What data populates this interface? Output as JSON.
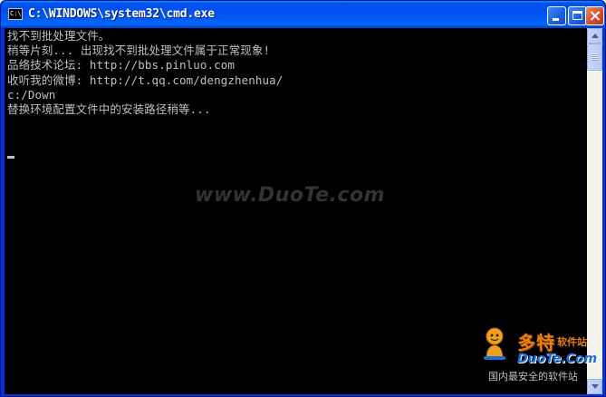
{
  "window": {
    "title": "C:\\WINDOWS\\system32\\cmd.exe",
    "icon": "C:\\"
  },
  "console": {
    "lines": [
      "找不到批处理文件。",
      "稍等片刻... 出现找不到批处理文件属于正常现象!",
      "品络技术论坛: http://bbs.pinluo.com",
      "收听我的微博: http://t.qq.com/dengzhenhua/",
      "c:/Down",
      "替换环境配置文件中的安装路径稍等..."
    ]
  },
  "watermark": "www.DuoTe.com",
  "logo": {
    "name": "多特",
    "tag": "软件站",
    "domain": "DuoTe.Com",
    "slogan": "国内最安全的软件站"
  },
  "colors": {
    "console_bg": "#000000",
    "console_text": "#c0c0c0",
    "titlebar": "#0054e3",
    "logo_orange": "#e77e10",
    "logo_blue": "#1a6ed8"
  }
}
